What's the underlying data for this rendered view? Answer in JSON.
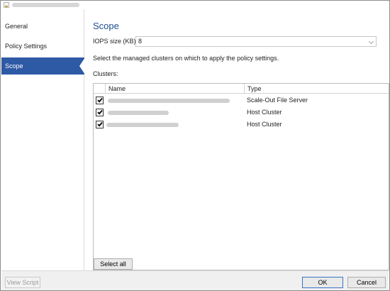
{
  "sidebar": {
    "items": [
      {
        "label": "General"
      },
      {
        "label": "Policy Settings"
      },
      {
        "label": "Scope"
      }
    ],
    "active_index": 2,
    "active_color": "#2e59a5"
  },
  "main": {
    "title": "Scope",
    "title_color": "#1f4d8f",
    "iops": {
      "label": "IOPS size (KB):",
      "value": "8"
    },
    "instruction": "Select the managed clusters on which to apply the policy settings.",
    "clusters_label": "Clusters:",
    "table": {
      "columns": [
        "Name",
        "Type"
      ],
      "rows": [
        {
          "checked": true,
          "name": "",
          "type": "Scale-Out File Server"
        },
        {
          "checked": true,
          "name": "",
          "type": "Host Cluster"
        },
        {
          "checked": true,
          "name": "",
          "type": "Host Cluster"
        }
      ]
    },
    "select_all_label": "Select all"
  },
  "footer": {
    "view_script_label": "View Script",
    "ok_label": "OK",
    "cancel_label": "Cancel"
  },
  "icons": [
    "app-icon",
    "checkbox-checked-icon",
    "chevron-down-icon"
  ]
}
